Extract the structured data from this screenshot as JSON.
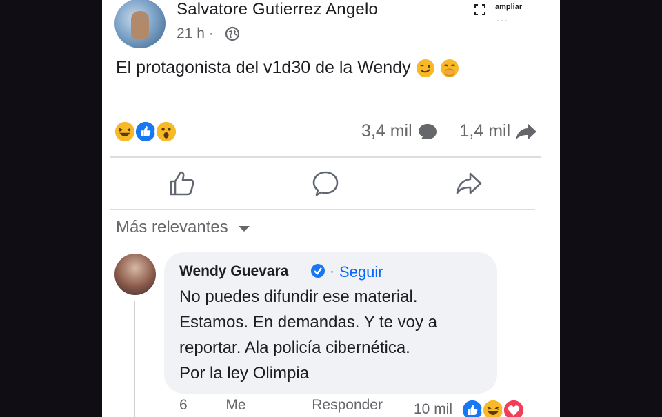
{
  "post": {
    "author": "Salvatore Gutierrez Angelo",
    "time": "21 h ·",
    "expand_label": "ampliar",
    "expand_dots": "···",
    "text": "El protagonista del v1d30 de la Wendy",
    "text_emojis": [
      "winking-face",
      "face-with-hand-over-mouth"
    ],
    "reactions": [
      "haha",
      "like",
      "wow"
    ],
    "comment_count": "3,4 mil",
    "share_count": "1,4 mil"
  },
  "actions": {
    "like_icon": "thumbs-up-icon",
    "comment_icon": "comment-bubble-icon",
    "share_icon": "share-arrow-icon"
  },
  "comments_sort": {
    "label": "Más relevantes"
  },
  "comment": {
    "author": "Wendy Guevara",
    "separator": "·",
    "follow_label": "Seguir",
    "lines": [
      "No puedes difundir ese material.",
      "Estamos. En demandas. Y te voy a",
      "reportar. Ala policía cibernética.",
      "Por la ley Olimpia"
    ],
    "time": "6",
    "like_label": "Me",
    "reply_label": "Responder",
    "reaction_count": "10 mil",
    "reactions": [
      "like",
      "haha",
      "love"
    ]
  },
  "colors": {
    "background": "#110d14",
    "card": "#ffffff",
    "secondary_text": "#65676b",
    "link": "#0866ff",
    "bubble": "#f0f2f5",
    "like_blue": "#1877f2",
    "love_red": "#f33e58",
    "haha_yellow": "#f7b928"
  }
}
